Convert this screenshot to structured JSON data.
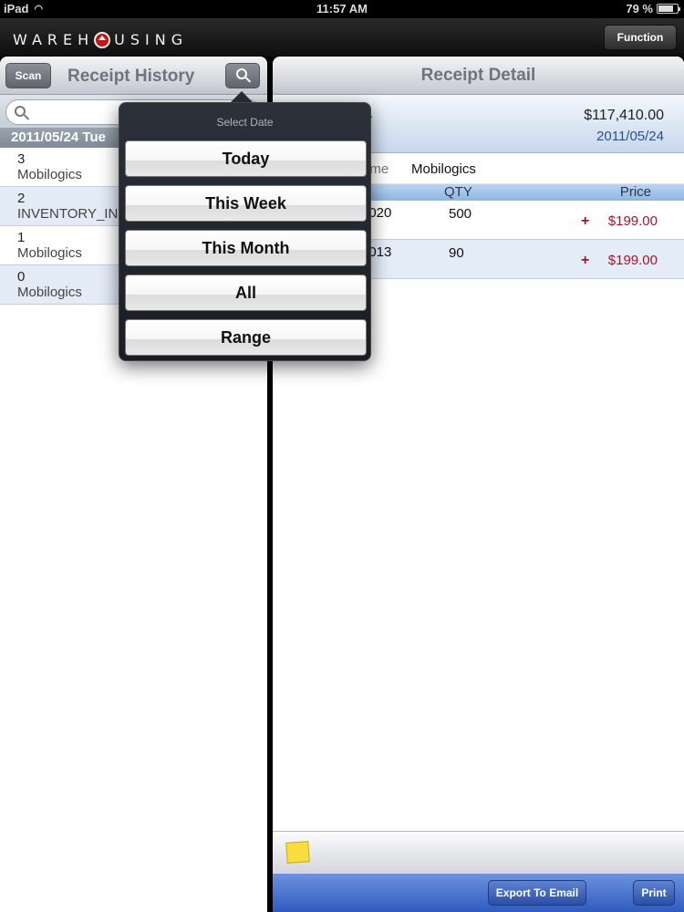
{
  "status": {
    "device": "iPad",
    "time": "11:57 AM",
    "battery": "79 %",
    "battery_level": 0.79
  },
  "app": {
    "logo": "WAREHOUSING",
    "function_label": "Function"
  },
  "left": {
    "scan_label": "Scan",
    "title": "Receipt History",
    "search_placeholder": "",
    "section_header": "2011/05/24 Tue",
    "items": [
      {
        "number": "3",
        "vendor": "Mobilogics"
      },
      {
        "number": "2",
        "vendor": "INVENTORY_IN"
      },
      {
        "number": "1",
        "vendor": "Mobilogics"
      },
      {
        "number": "0",
        "vendor": "Mobilogics"
      }
    ]
  },
  "right": {
    "title": "Receipt Detail",
    "summary_dot": ".",
    "total": "$117,410.00",
    "date": "2011/05/24",
    "vendor_label": "ame",
    "vendor_value": "Mobilogics",
    "col_qty": "QTY",
    "col_price": "Price",
    "items": [
      {
        "code": "0020",
        "qty": "500",
        "plus": "+",
        "price": "$199.00"
      },
      {
        "code": "0013",
        "qty": "90",
        "plus": "+",
        "price": "$199.00"
      }
    ],
    "export_label": "Export To Email",
    "print_label": "Print"
  },
  "popover": {
    "title": "Select Date",
    "options": [
      "Today",
      "This Week",
      "This Month",
      "All",
      "Range"
    ]
  },
  "colors": {
    "price_red": "#a1152a",
    "toolbar_blue": "#2f5bc0",
    "logo_red": "#c01818"
  }
}
